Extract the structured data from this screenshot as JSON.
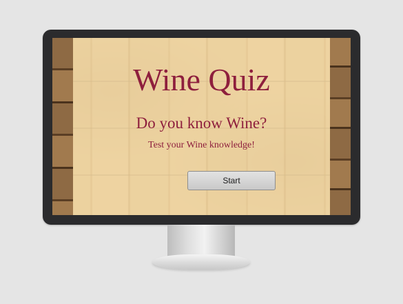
{
  "quiz": {
    "title": "Wine Quiz",
    "subtitle": "Do you know Wine?",
    "tagline": "Test your Wine knowledge!",
    "start_label": "Start"
  },
  "colors": {
    "title_text": "#8e1f3d",
    "overlay": "#f6deaa",
    "button": "#d6d6d6",
    "monitor_bezel": "#2b2b2d"
  }
}
